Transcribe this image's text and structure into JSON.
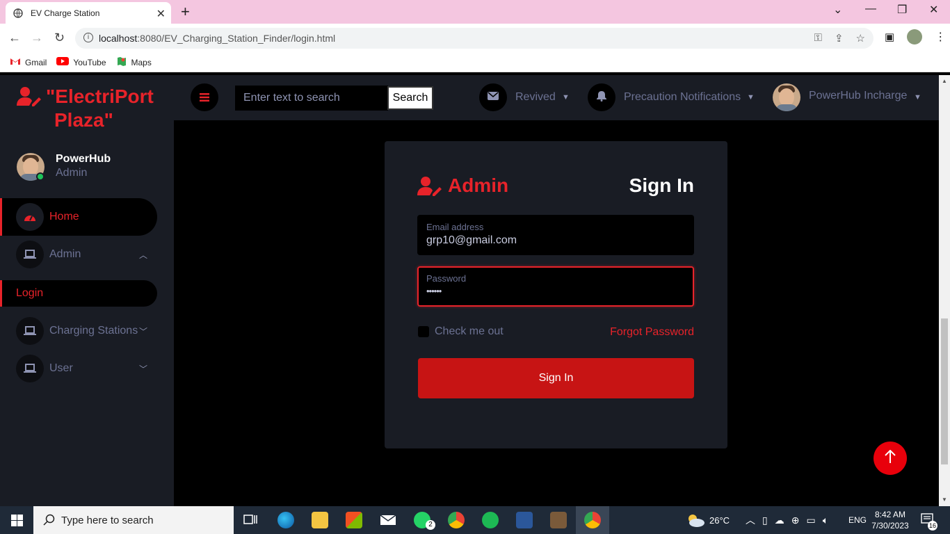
{
  "browser": {
    "tab_title": "EV Charge Station",
    "url_host": "localhost",
    "url_rest": ":8080/EV_Charging_Station_Finder/login.html",
    "bookmarks": [
      "Gmail",
      "YouTube",
      "Maps"
    ]
  },
  "sidebar": {
    "brand_line1": "\"ElectriPort",
    "brand_line2": "Plaza\"",
    "profile_name": "PowerHub",
    "profile_role": "Admin",
    "items": [
      {
        "label": "Home",
        "icon": "speedometer-icon"
      },
      {
        "label": "Admin",
        "icon": "laptop-icon"
      },
      {
        "label": "Login"
      },
      {
        "label": "Charging Stations",
        "icon": "laptop-icon"
      },
      {
        "label": "User",
        "icon": "laptop-icon"
      }
    ]
  },
  "topnav": {
    "search_placeholder": "Enter text to search",
    "search_button": "Search",
    "messages_label": "Revived",
    "notifications_label": "Precaution Notifications",
    "user_label": "PowerHub Incharge"
  },
  "login": {
    "role_title": "Admin",
    "heading": "Sign In",
    "email_label": "Email address",
    "email_value": "grp10@gmail.com",
    "password_label": "Password",
    "password_value": "••••••",
    "remember_label": "Check me out",
    "forgot_label": "Forgot Password",
    "submit_label": "Sign In"
  },
  "taskbar": {
    "search_placeholder": "Type here to search",
    "weather": "26°C",
    "language": "ENG",
    "time": "8:42 AM",
    "date": "7/30/2023",
    "whatsapp_badge": "2",
    "notification_count": "16"
  },
  "colors": {
    "accent": "#e8232a",
    "sidebar_bg": "#191c24",
    "page_bg": "#000000",
    "button_bg": "#c71414"
  }
}
